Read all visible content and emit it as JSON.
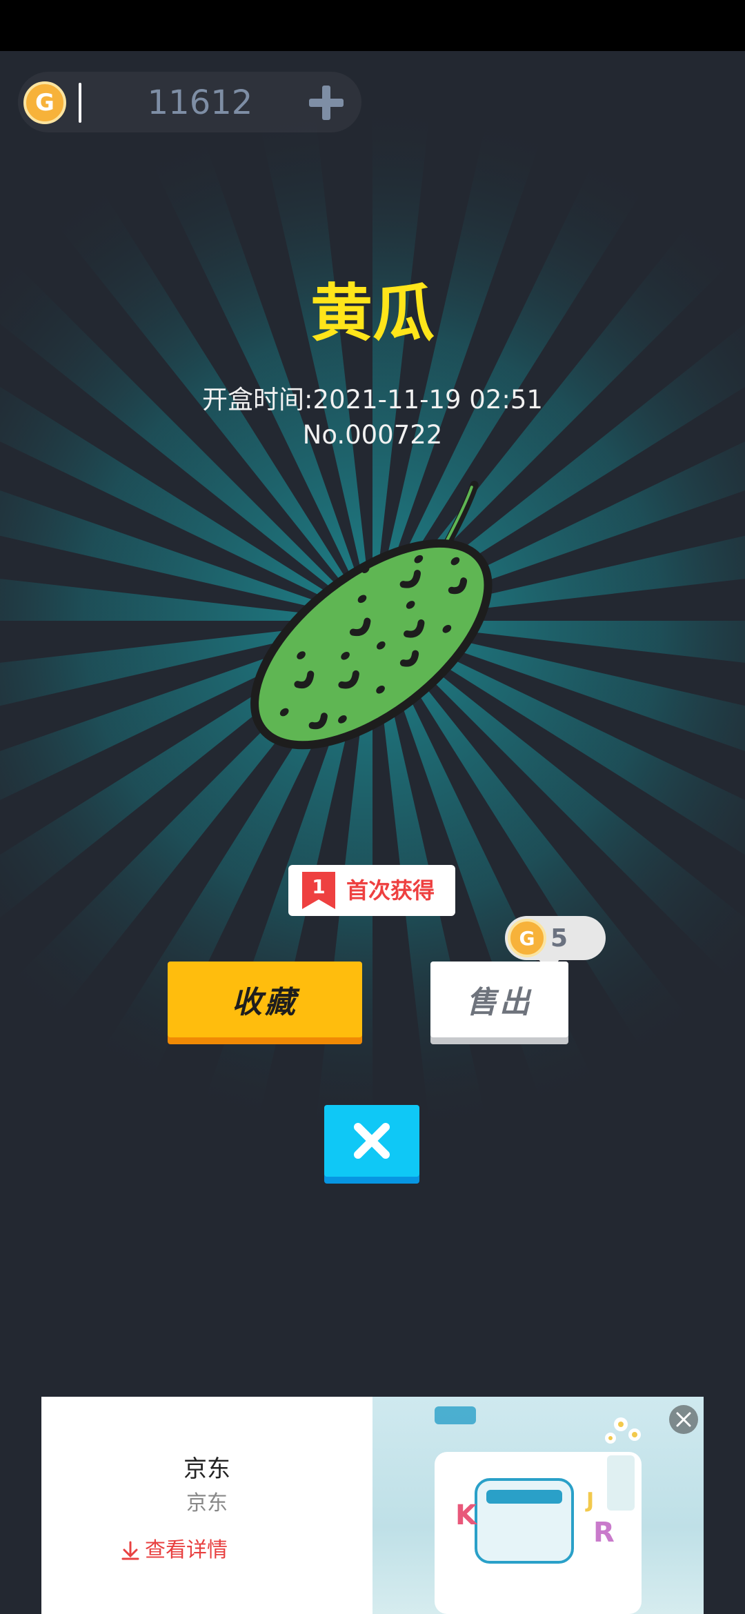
{
  "header": {
    "coin_symbol": "G",
    "coin_amount": "11612",
    "add_icon": "plus-icon"
  },
  "item": {
    "name": "黄瓜",
    "open_time": "开盒时间:2021-11-19 02:51",
    "serial": "No.000722",
    "image_icon": "cucumber-illustration"
  },
  "badge": {
    "number": "1",
    "text": "首次获得"
  },
  "sell_price": {
    "coin_symbol": "G",
    "value": "5"
  },
  "actions": {
    "collect_label": "收藏",
    "sell_label": "售出",
    "close_icon": "close-icon"
  },
  "ad": {
    "title": "京东",
    "subtitle": "京东",
    "detail_label": "查看详情",
    "detail_icon": "download-arrow-icon",
    "close_icon": "close-icon"
  },
  "colors": {
    "background": "#232831",
    "title": "#ffe51a",
    "collect_button": "#ffbd0d",
    "close_button": "#0fc8f6",
    "badge_red": "#ee4040",
    "cucumber_green": "#5fb653"
  }
}
